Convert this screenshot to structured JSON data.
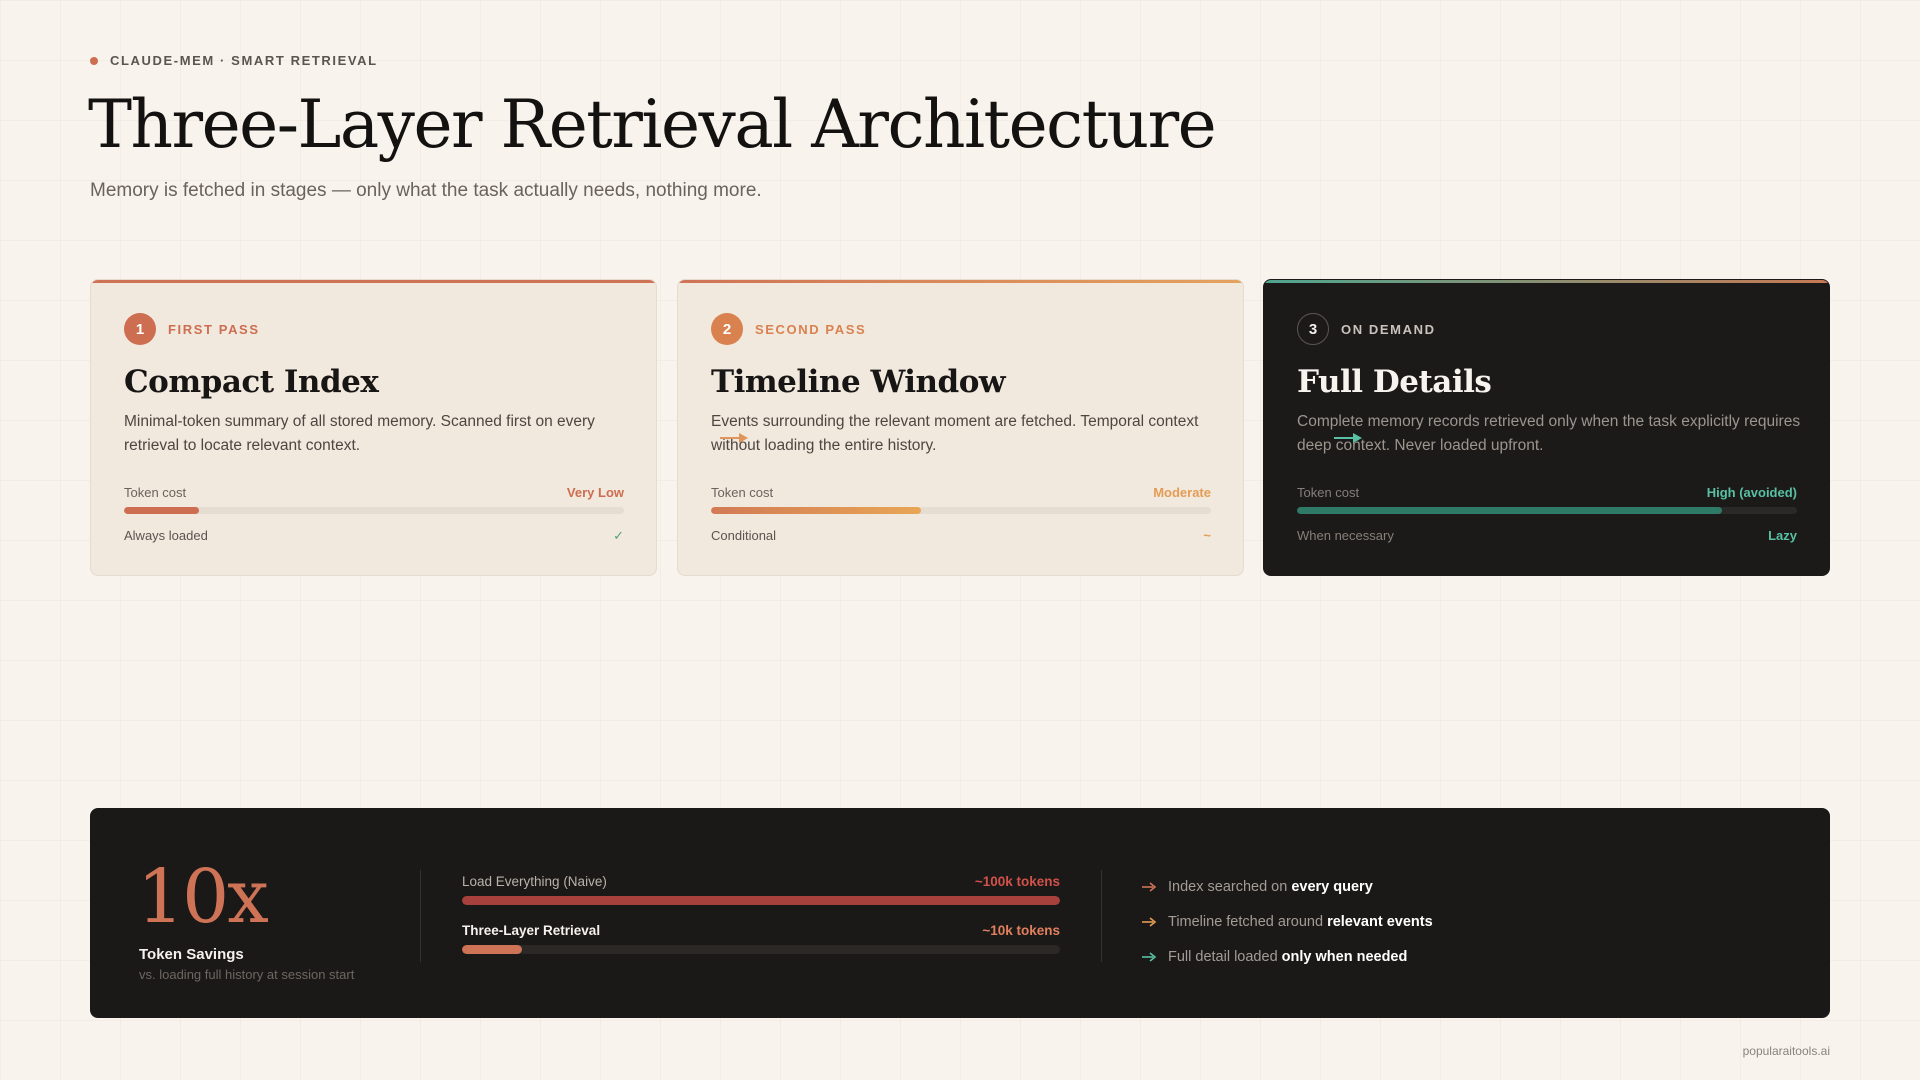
{
  "header": {
    "eyebrow": "CLAUDE-MEM · SMART RETRIEVAL",
    "title": "Three-Layer Retrieval Architecture",
    "subtitle": "Memory is fetched in stages — only what the task actually needs, nothing more."
  },
  "cards": [
    {
      "step": "1",
      "step_label": "FIRST PASS",
      "title": "Compact Index",
      "description": "Minimal-token summary of all stored memory. Scanned first on every retrieval to locate relevant context.",
      "cost_label": "Token cost",
      "cost_value": "Very Low",
      "cost_level": 0.15,
      "foot_label": "Always loaded",
      "foot_value": "✓"
    },
    {
      "step": "2",
      "step_label": "SECOND PASS",
      "title": "Timeline Window",
      "description": "Events surrounding the relevant moment are fetched. Temporal context without loading the entire history.",
      "cost_label": "Token cost",
      "cost_value": "Moderate",
      "cost_level": 0.42,
      "foot_label": "Conditional",
      "foot_value": "~"
    },
    {
      "step": "3",
      "step_label": "ON DEMAND",
      "title": "Full Details",
      "description": "Complete memory records retrieved only when the task explicitly requires deep context. Never loaded upfront.",
      "cost_label": "Token cost",
      "cost_value": "High (avoided)",
      "cost_level": 0.85,
      "foot_label": "When necessary",
      "foot_value": "Lazy"
    }
  ],
  "summary": {
    "multiplier": "10x",
    "label": "Token Savings",
    "sublabel": "vs. loading full history at session start",
    "comparisons": [
      {
        "name": "Load Everything (Naive)",
        "value": "~100k tokens",
        "level": 1.0
      },
      {
        "name": "Three-Layer Retrieval",
        "value": "~10k tokens",
        "level": 0.1
      }
    ],
    "points": [
      {
        "text": "Index searched on ",
        "strong": "every query"
      },
      {
        "text": "Timeline fetched around ",
        "strong": "relevant events"
      },
      {
        "text": "Full detail loaded ",
        "strong": "only when needed"
      }
    ]
  },
  "footer": "popularaitools.ai",
  "colors": {
    "accent": "#cf7356",
    "amber": "#e49d55",
    "teal": "#58c0a4",
    "dark": "#1b1918",
    "paper": "#f8f3ed"
  },
  "icons": {
    "connector": "arrow-right-icon",
    "point_arrow": "arrow-right-icon",
    "check": "check-icon"
  }
}
